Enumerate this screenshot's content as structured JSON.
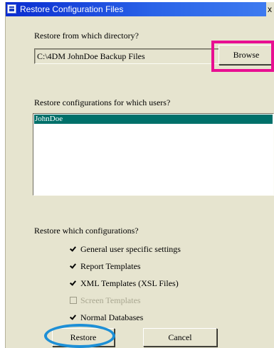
{
  "window": {
    "title": "Restore Configuration Files",
    "close_glyph": "x"
  },
  "directory": {
    "prompt": "Restore from which directory?",
    "path": "C:\\4DM JohnDoe Backup Files",
    "browse_label": "Browse"
  },
  "users": {
    "prompt": "Restore configurations for which users?",
    "items": [
      {
        "label": "JohnDoe",
        "selected": true
      }
    ]
  },
  "configurations": {
    "prompt": "Restore which configurations?",
    "options": [
      {
        "label": "General user specific settings",
        "checked": true,
        "enabled": true
      },
      {
        "label": "Report Templates",
        "checked": true,
        "enabled": true
      },
      {
        "label": "XML Templates (XSL Files)",
        "checked": true,
        "enabled": true
      },
      {
        "label": "Screen Templates",
        "checked": false,
        "enabled": false
      },
      {
        "label": "Normal Databases",
        "checked": true,
        "enabled": true
      }
    ]
  },
  "actions": {
    "restore_label": "Restore",
    "cancel_label": "Cancel"
  },
  "annotations": {
    "highlight_color": "#e80f92",
    "ellipse_color": "#1d8fd6"
  },
  "colors": {
    "titlebar": "#0a2cd0",
    "dialog_bg": "#e6e4cf",
    "selection": "#00706a"
  }
}
